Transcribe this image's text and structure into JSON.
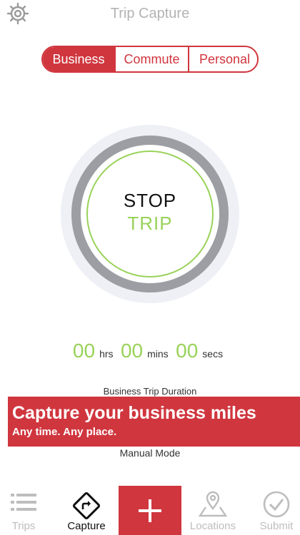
{
  "header": {
    "title": "Trip Capture",
    "settings_icon": "gear-icon"
  },
  "segments": [
    {
      "label": "Business",
      "active": true
    },
    {
      "label": "Commute",
      "active": false
    },
    {
      "label": "Personal",
      "active": false
    }
  ],
  "trip_button": {
    "line1": "STOP",
    "line2": "TRIP"
  },
  "timer": {
    "hours": "00",
    "hours_unit": "hrs",
    "minutes": "00",
    "minutes_unit": "mins",
    "seconds": "00",
    "seconds_unit": "secs"
  },
  "duration_label": "Business Trip Duration",
  "banner": {
    "title": "Capture your business miles",
    "subtitle": "Any time. Any place."
  },
  "manual_mode": "Manual Mode",
  "tabs": [
    {
      "label": "Trips",
      "icon": "list-icon"
    },
    {
      "label": "Capture",
      "icon": "navigation-diamond-icon"
    },
    {
      "label": "",
      "icon": "plus-icon"
    },
    {
      "label": "Locations",
      "icon": "map-pin-icon"
    },
    {
      "label": "Submit",
      "icon": "checkmark-circle-icon"
    }
  ],
  "colors": {
    "accent": "#d0363e",
    "green": "#99d25a",
    "gray_ring": "#9c9ea3",
    "inactive_text": "#bdbdbd"
  }
}
